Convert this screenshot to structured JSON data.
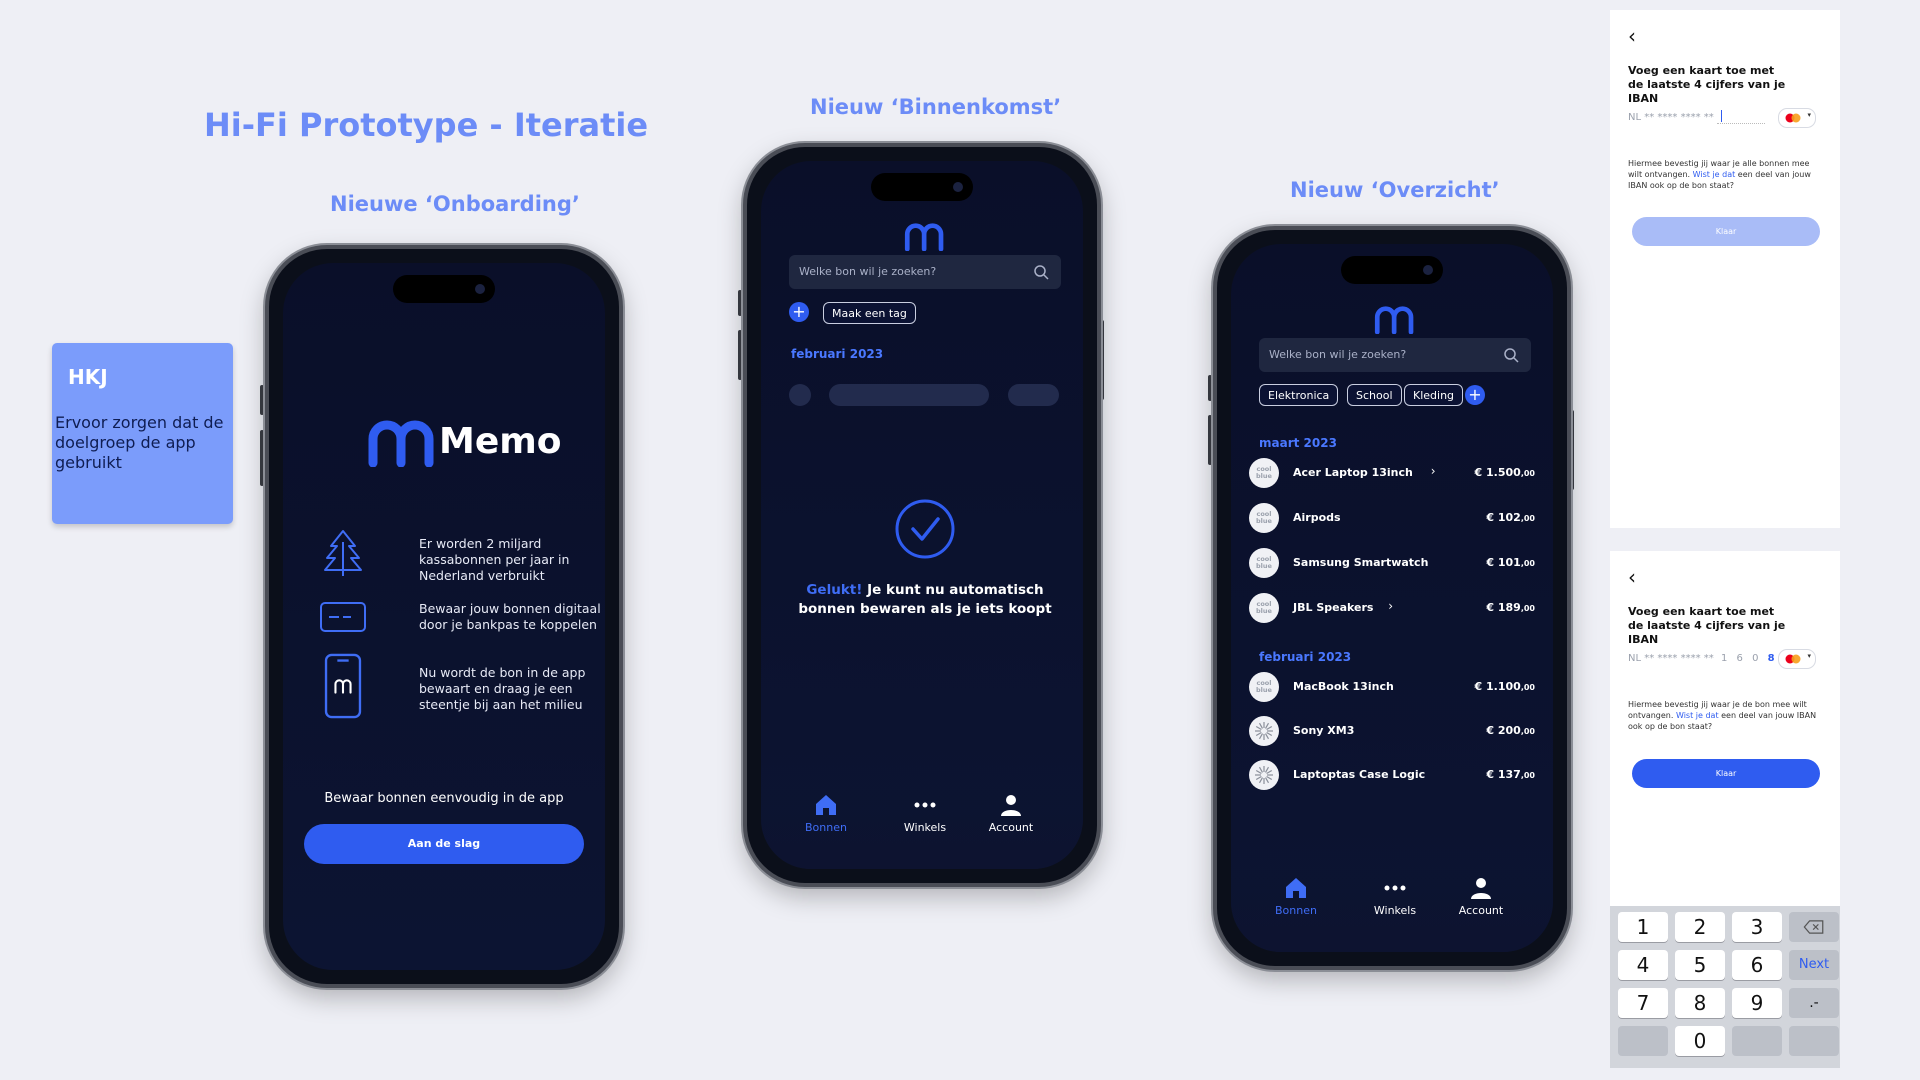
{
  "headings": {
    "main": "Hi-Fi Prototype - Iteratie",
    "onboarding": "Nieuwe ‘Onboarding’",
    "binnenkomst": "Nieuw ‘Binnenkomst’",
    "overzicht": "Nieuw ‘Overzicht’"
  },
  "sticky": {
    "title": "HKJ",
    "body": "Ervoor zorgen dat de doelgroep de app gebruikt"
  },
  "onboarding": {
    "app_name": "Memo",
    "features": [
      {
        "icon": "tree-icon",
        "text": "Er worden 2 miljard kassabonnen per jaar in Nederland verbruikt"
      },
      {
        "icon": "bank-card-icon",
        "text": "Bewaar jouw bonnen digitaal door je bankpas te koppelen"
      },
      {
        "icon": "phone-memo-icon",
        "text": "Nu wordt de bon in de app bewaart en draag je een steentje bij aan het milieu"
      }
    ],
    "tagline": "Bewaar bonnen eenvoudig in de app",
    "cta": "Aan de slag"
  },
  "binnenkomst": {
    "search_placeholder": "Welke bon wil je zoeken?",
    "tag_button": "Maak een tag",
    "month": "februari 2023",
    "success_highlight": "Gelukt!",
    "success_text": " Je kunt nu automatisch bonnen bewaren als je iets koopt"
  },
  "overzicht": {
    "search_placeholder": "Welke bon wil je zoeken?",
    "tags": [
      "Elektronica",
      "School",
      "Kleding"
    ],
    "groups": [
      {
        "month": "maart 2023",
        "items": [
          {
            "name": "Acer Laptop 13inch",
            "price": "€ 1.500",
            "cents": ",00",
            "chevron": true,
            "logo": "coolblue"
          },
          {
            "name": "Airpods",
            "price": "€ 102",
            "cents": ",00",
            "chevron": false,
            "logo": "coolblue"
          },
          {
            "name": "Samsung Smartwatch",
            "price": "€ 101",
            "cents": ",00",
            "chevron": false,
            "logo": "coolblue"
          },
          {
            "name": "JBL Speakers",
            "price": "€ 189",
            "cents": ",00",
            "chevron": true,
            "logo": "coolblue"
          }
        ]
      },
      {
        "month": "februari 2023",
        "items": [
          {
            "name": "MacBook 13inch",
            "price": "€ 1.100",
            "cents": ",00",
            "chevron": false,
            "logo": "coolblue"
          },
          {
            "name": "Sony XM3",
            "price": "€ 200",
            "cents": ",00",
            "chevron": false,
            "logo": "burst"
          },
          {
            "name": "Laptoptas Case Logic",
            "price": "€ 137",
            "cents": ",00",
            "chevron": false,
            "logo": "burst"
          }
        ]
      }
    ]
  },
  "tabs": {
    "bonnen": "Bonnen",
    "winkels": "Winkels",
    "account": "Account"
  },
  "logo_text": "cool blue",
  "iban_panel_1": {
    "back": "‹",
    "title": "Voeg een kaart toe met de laatste 4 cijfers van je IBAN",
    "prefix": "NL",
    "masked": "** **** **** **",
    "digits": "",
    "text_before": "Hiermee bevestig jij waar je alle bonnen mee wilt ontvangen. ",
    "link": "Wist je dat",
    "text_after": " een deel van jouw IBAN ook op de bon staat?",
    "button": "Klaar",
    "button_enabled": false
  },
  "iban_panel_2": {
    "back": "‹",
    "title": "Voeg een kaart toe met de laatste 4 cijfers van je IBAN",
    "prefix": "NL",
    "masked": "** **** **** **",
    "digits": [
      "1",
      "6",
      "0",
      "8"
    ],
    "text_before": "Hiermee bevestig jij waar je de bon mee wilt ontvangen. ",
    "link": "Wist je dat",
    "text_after": " een deel van jouw IBAN ook op de bon staat?",
    "button": "Klaar",
    "button_enabled": true
  },
  "keypad": {
    "keys": [
      "1",
      "2",
      "3",
      "4",
      "5",
      "6",
      "Next",
      "7",
      "8",
      "9",
      ".-",
      "0"
    ],
    "backspace": "backspace-icon"
  },
  "colors": {
    "accent": "#2f5cf0",
    "heading": "#6c8cf7",
    "sticky": "#7b9cfb",
    "screen_bg": "#0a0f29"
  }
}
